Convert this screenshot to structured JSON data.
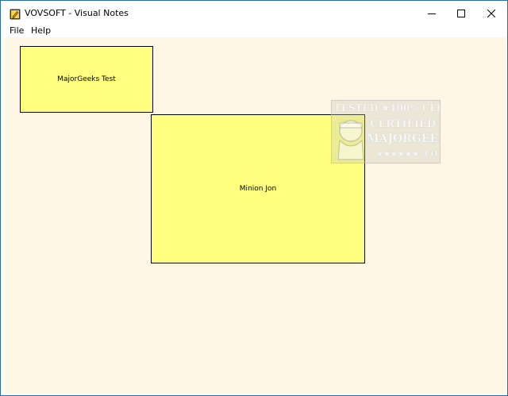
{
  "window": {
    "title": "VOVSOFT - Visual Notes",
    "app_icon": "pencil-notepad-icon",
    "controls": {
      "minimize": "minimize-icon",
      "maximize": "maximize-icon",
      "close": "close-icon"
    }
  },
  "menu": {
    "items": [
      {
        "label": "File"
      },
      {
        "label": "Help"
      }
    ]
  },
  "notes": [
    {
      "text": "MajorGeeks Test",
      "color": "#ffff80"
    },
    {
      "text": "Minion Jon",
      "color": "#ffff80"
    }
  ],
  "canvas": {
    "background": "#fff6e5"
  },
  "watermark": {
    "line1": "TESTED ★100% CLEAN",
    "line2": "CERTIFIED",
    "line3": "MAJORGEEKS",
    "line4": "★★★★★★ .COM"
  }
}
